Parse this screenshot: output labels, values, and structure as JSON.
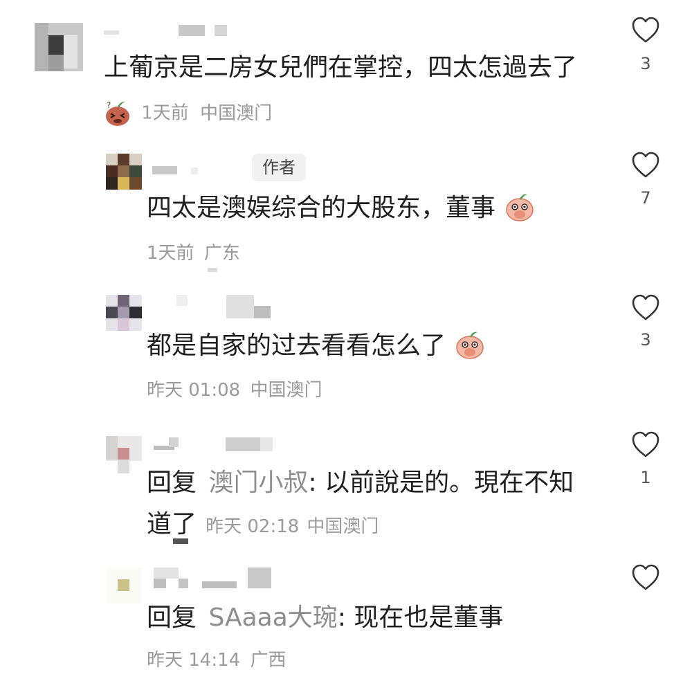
{
  "comments": [
    {
      "text": "上葡京是二房女兒們在掌控，四太怎過去了",
      "time": "1天前",
      "location": "中国澳门",
      "likes": "3",
      "meta_emoji": "sweat-face-emoji"
    },
    {
      "author_badge": "作者",
      "text": "四太是澳娱综合的大股东，董事",
      "time": "1天前",
      "location": "广东",
      "likes": "7",
      "text_emoji": "covering-mouth-emoji"
    },
    {
      "text": "都是自家的过去看看怎么了",
      "time": "昨天 01:08",
      "location": "中国澳门",
      "likes": "3",
      "text_emoji": "covering-mouth-emoji"
    },
    {
      "reply_prefix": "回复",
      "reply_to": "澳门小叔",
      "reply_sep": ":",
      "text_line1": "以前說是的。現在不知",
      "text_line2": "道了",
      "time": "昨天 02:18",
      "location": "中国澳门",
      "likes": "1"
    },
    {
      "reply_prefix": "回复",
      "reply_to": "SAaaa大琬",
      "reply_sep": ":",
      "text": "现在也是董事",
      "time": "昨天 14:14",
      "location": "广西",
      "likes": ""
    }
  ],
  "colors": {
    "text": "#1f1f1f",
    "meta": "#9a9a9a",
    "icon": "#333333",
    "badge_bg": "#f1f1f1"
  }
}
